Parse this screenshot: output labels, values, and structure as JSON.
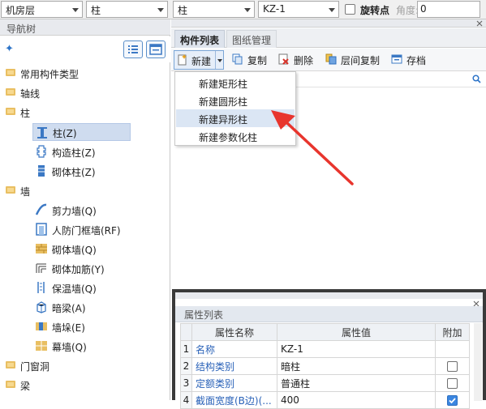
{
  "toolbar": {
    "floor": "机房层",
    "category": "柱",
    "type": "柱",
    "component": "KZ-1",
    "rotate_label": "旋转点",
    "angle_label": "角度:",
    "angle_value": "0"
  },
  "nav": {
    "title": "导航树",
    "tree": [
      {
        "label": "常用构件类型",
        "level": 0
      },
      {
        "label": "轴线",
        "level": 0
      },
      {
        "label": "柱",
        "level": 0
      },
      {
        "label": "柱(Z)",
        "level": 1,
        "icon": "column-icon",
        "selected": true
      },
      {
        "label": "构造柱(Z)",
        "level": 1,
        "icon": "construct-column-icon"
      },
      {
        "label": "砌体柱(Z)",
        "level": 1,
        "icon": "masonry-column-icon"
      },
      {
        "label": "墙",
        "level": 0
      },
      {
        "label": "剪力墙(Q)",
        "level": 1,
        "icon": "shear-wall-icon"
      },
      {
        "label": "人防门框墙(RF)",
        "level": 1,
        "icon": "civil-door-wall-icon"
      },
      {
        "label": "砌体墙(Q)",
        "level": 1,
        "icon": "masonry-wall-icon"
      },
      {
        "label": "砌体加筋(Y)",
        "level": 1,
        "icon": "masonry-rebar-icon"
      },
      {
        "label": "保温墙(Q)",
        "level": 1,
        "icon": "insulation-wall-icon"
      },
      {
        "label": "暗梁(A)",
        "level": 1,
        "icon": "hidden-beam-icon"
      },
      {
        "label": "墙垛(E)",
        "level": 1,
        "icon": "wall-pier-icon"
      },
      {
        "label": "幕墙(Q)",
        "level": 1,
        "icon": "curtain-wall-icon"
      },
      {
        "label": "门窗洞",
        "level": 0
      },
      {
        "label": "梁",
        "level": 0
      }
    ]
  },
  "tabs": [
    {
      "label": "构件列表",
      "active": true
    },
    {
      "label": "图纸管理",
      "active": false
    }
  ],
  "component_toolbar": {
    "new": "新建",
    "copy": "复制",
    "delete": "删除",
    "floor_copy": "层间复制",
    "save": "存档"
  },
  "new_menu": [
    {
      "label": "新建矩形柱"
    },
    {
      "label": "新建圆形柱"
    },
    {
      "label": "新建异形柱",
      "highlighted": true
    },
    {
      "label": "新建参数化柱"
    }
  ],
  "attributes": {
    "title": "属性列表",
    "headers": {
      "name": "属性名称",
      "value": "属性值",
      "extra": "附加"
    },
    "rows": [
      {
        "num": "1",
        "name": "名称",
        "value": "KZ-1",
        "check": null
      },
      {
        "num": "2",
        "name": "结构类别",
        "value": "暗柱",
        "check": false
      },
      {
        "num": "3",
        "name": "定额类别",
        "value": "普通柱",
        "check": false
      },
      {
        "num": "4",
        "name": "截面宽度(B边)(...",
        "value": "400",
        "check": true
      }
    ]
  },
  "colors": {
    "accent": "#2d74c8",
    "arrow": "#e8352d",
    "selection": "#cfdcef"
  }
}
